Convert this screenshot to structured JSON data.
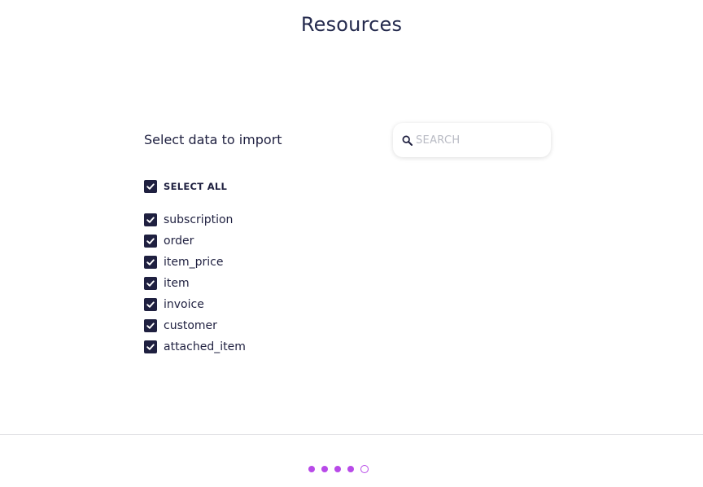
{
  "page": {
    "title": "Resources"
  },
  "import_panel": {
    "heading": "Select data to import",
    "search": {
      "placeholder": "SEARCH",
      "value": "",
      "icon": "search-icon"
    },
    "select_all": {
      "label": "SELECT ALL",
      "checked": true
    },
    "resources": [
      {
        "label": "subscription",
        "checked": true
      },
      {
        "label": "order",
        "checked": true
      },
      {
        "label": "item_price",
        "checked": true
      },
      {
        "label": "item",
        "checked": true
      },
      {
        "label": "invoice",
        "checked": true
      },
      {
        "label": "customer",
        "checked": true
      },
      {
        "label": "attached_item",
        "checked": true
      }
    ]
  },
  "pager": {
    "total_steps": 5,
    "current_step": 5
  },
  "colors": {
    "text_primary": "#1f2040",
    "checkbox": "#1f2040",
    "accent": "#b84ae8",
    "placeholder": "#b9bbc4"
  }
}
